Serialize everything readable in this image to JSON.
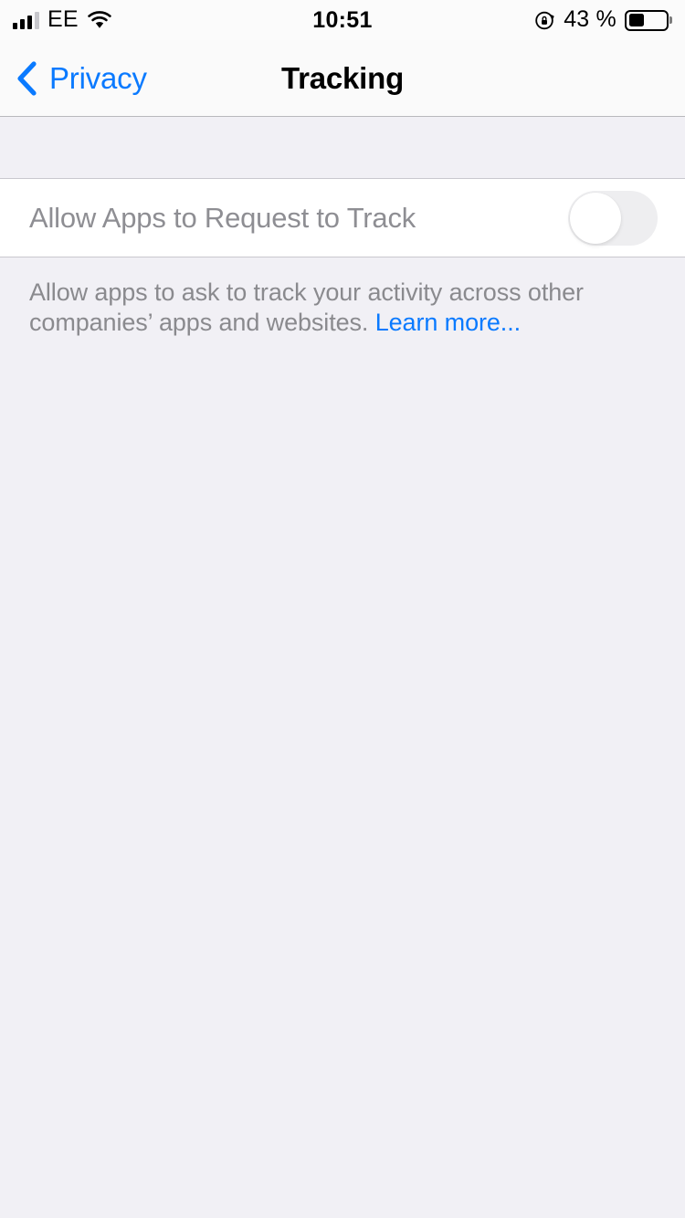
{
  "status_bar": {
    "carrier": "EE",
    "signal_bars_filled": 3,
    "signal_bars_total": 4,
    "wifi_icon": "wifi-icon",
    "time": "10:51",
    "rotation_lock_icon": "rotation-lock-icon",
    "battery_percent_label": "43 %",
    "battery_level": 43,
    "battery_icon": "battery-icon"
  },
  "nav_bar": {
    "back_icon": "chevron-left-icon",
    "back_label": "Privacy",
    "title": "Tracking"
  },
  "main": {
    "cell": {
      "label": "Allow Apps to Request to Track",
      "toggle_state": "off",
      "toggle_enabled": false
    },
    "footer": {
      "text": "Allow apps to ask to track your activity across other companies’ apps and websites. ",
      "link_label": "Learn more..."
    }
  },
  "colors": {
    "accent_blue": "#0A7AFF",
    "page_background": "#F1F0F5",
    "cell_background": "#FFFFFF",
    "disabled_text": "#8E8E93",
    "footer_text": "#8A8A8E",
    "separator": "#C9C8CE"
  }
}
